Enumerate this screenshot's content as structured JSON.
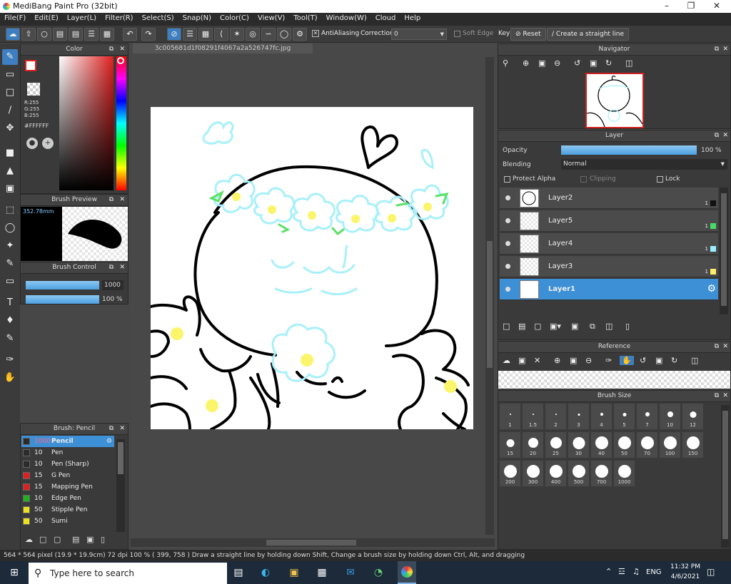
{
  "app": {
    "title": "MediBang Paint Pro (32bit)"
  },
  "menu": [
    "File(F)",
    "Edit(E)",
    "Layer(L)",
    "Filter(R)",
    "Select(S)",
    "Snap(N)",
    "Color(C)",
    "View(V)",
    "Tool(T)",
    "Window(W)",
    "Cloud",
    "Help"
  ],
  "toolbar": {
    "antialiasing": "AntiAliasing",
    "correction_label": "Correction",
    "correction_value": "0",
    "soft_edge": "Soft Edge",
    "key": "Key",
    "reset": "Reset",
    "straight_line": "Create a straight line"
  },
  "color_panel": {
    "title": "Color",
    "r": "R:255",
    "g": "G:255",
    "b": "B:255",
    "hex": "#FFFFFF"
  },
  "brush_preview": {
    "title": "Brush Preview",
    "size": "352.78mm"
  },
  "brush_control": {
    "title": "Brush Control",
    "size_value": "1000",
    "opacity_value": "100 %",
    "size_fraction": 1.0,
    "opacity_fraction": 1.0
  },
  "brush_list": {
    "title": "Brush: Pencil",
    "items": [
      {
        "size": "1000",
        "name": "Pencil",
        "color": "#2b2b2b",
        "selected": true
      },
      {
        "size": "10",
        "name": "Pen",
        "color": "#2b2b2b"
      },
      {
        "size": "10",
        "name": "Pen (Sharp)",
        "color": "#2b2b2b"
      },
      {
        "size": "15",
        "name": "G Pen",
        "color": "#e02020"
      },
      {
        "size": "15",
        "name": "Mapping Pen",
        "color": "#e02020"
      },
      {
        "size": "10",
        "name": "Edge Pen",
        "color": "#20b020"
      },
      {
        "size": "50",
        "name": "Stipple Pen",
        "color": "#e8e020"
      },
      {
        "size": "50",
        "name": "Sumi",
        "color": "#e8e020"
      }
    ]
  },
  "document": {
    "tab": "3c005681d1f08291f4067a2a526747fc.jpg"
  },
  "navigator": {
    "title": "Navigator"
  },
  "layer_panel": {
    "title": "Layer",
    "opacity_label": "Opacity",
    "opacity_value": "100 %",
    "opacity_fraction": 1.0,
    "blending_label": "Blending",
    "blending_value": "Normal",
    "protect_alpha": "Protect Alpha",
    "clipping": "Clipping",
    "lock": "Lock",
    "layers": [
      {
        "name": "Layer2",
        "num": "1",
        "color": "#111111"
      },
      {
        "name": "Layer5",
        "num": "1",
        "color": "#44dd66"
      },
      {
        "name": "Layer4",
        "num": "1",
        "color": "#99eeff"
      },
      {
        "name": "Layer3",
        "num": "1",
        "color": "#ffee66"
      },
      {
        "name": "Layer1",
        "num": "",
        "color": "",
        "selected": true
      }
    ]
  },
  "reference": {
    "title": "Reference"
  },
  "brush_size": {
    "title": "Brush Size",
    "sizes": [
      "1",
      "1.5",
      "2",
      "3",
      "4",
      "5",
      "7",
      "10",
      "12",
      "15",
      "20",
      "25",
      "30",
      "40",
      "50",
      "70",
      "100",
      "150",
      "200",
      "300",
      "400",
      "500",
      "700",
      "1000"
    ]
  },
  "status": {
    "text": "564 * 564 pixel   (19.9 * 19.9cm)   72 dpi   100 %   ( 399, 758 )   Draw a straight line by holding down Shift, Change a brush size by holding down Ctrl, Alt, and dragging"
  },
  "taskbar": {
    "search_placeholder": "Type here to search",
    "lang": "ENG",
    "time": "11:32 PM",
    "date": "4/6/2021"
  }
}
